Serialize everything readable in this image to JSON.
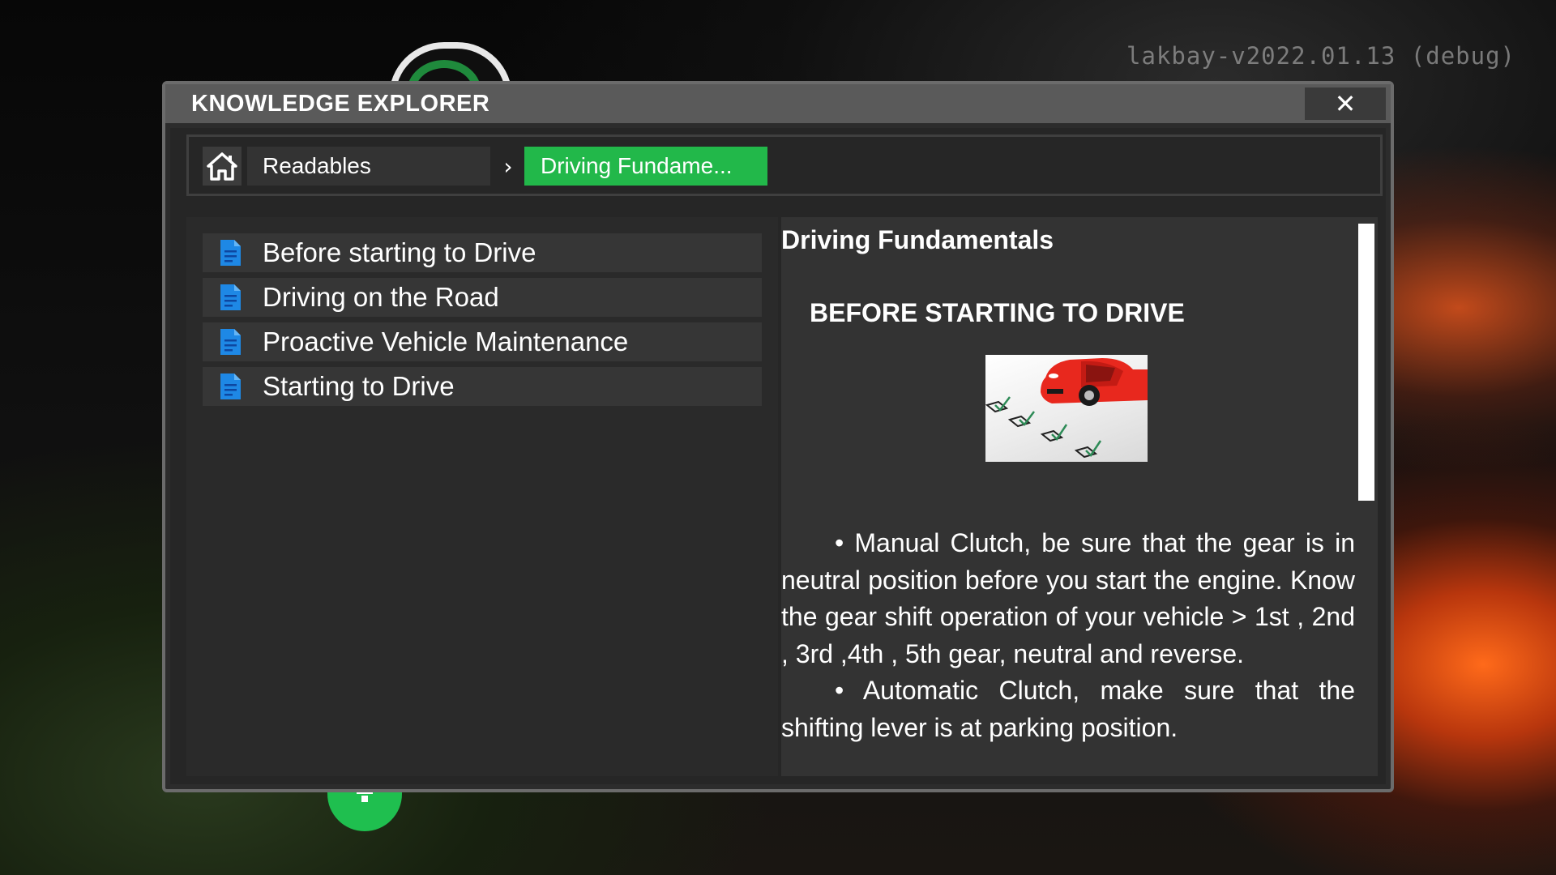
{
  "debug_label": "lakbay-v2022.01.13 (debug)",
  "window": {
    "title": "KNOWLEDGE EXPLORER",
    "close_label": "✕"
  },
  "breadcrumb": {
    "home_icon": "home-icon",
    "readables_label": "Readables",
    "separator": "›",
    "active_label": "Driving Fundame..."
  },
  "topics": [
    {
      "label": "Before starting to Drive",
      "icon": "document-icon"
    },
    {
      "label": "Driving on the Road",
      "icon": "document-icon"
    },
    {
      "label": "Proactive Vehicle Maintenance",
      "icon": "document-icon"
    },
    {
      "label": "Starting to Drive",
      "icon": "document-icon"
    }
  ],
  "reader": {
    "title": "Driving Fundamentals",
    "heading": "BEFORE STARTING TO DRIVE",
    "paragraphs": [
      "• Manual Clutch, be sure that the gear is in neutral position before you start the engine. Know the gear shift operation of your vehicle > 1st , 2nd , 3rd ,4th , 5th gear, neutral and reverse.",
      "• Automatic Clutch, make sure that the shifting lever is at parking position."
    ]
  },
  "colors": {
    "accent_green": "#22b84a",
    "doc_icon_blue": "#1e88e5"
  }
}
